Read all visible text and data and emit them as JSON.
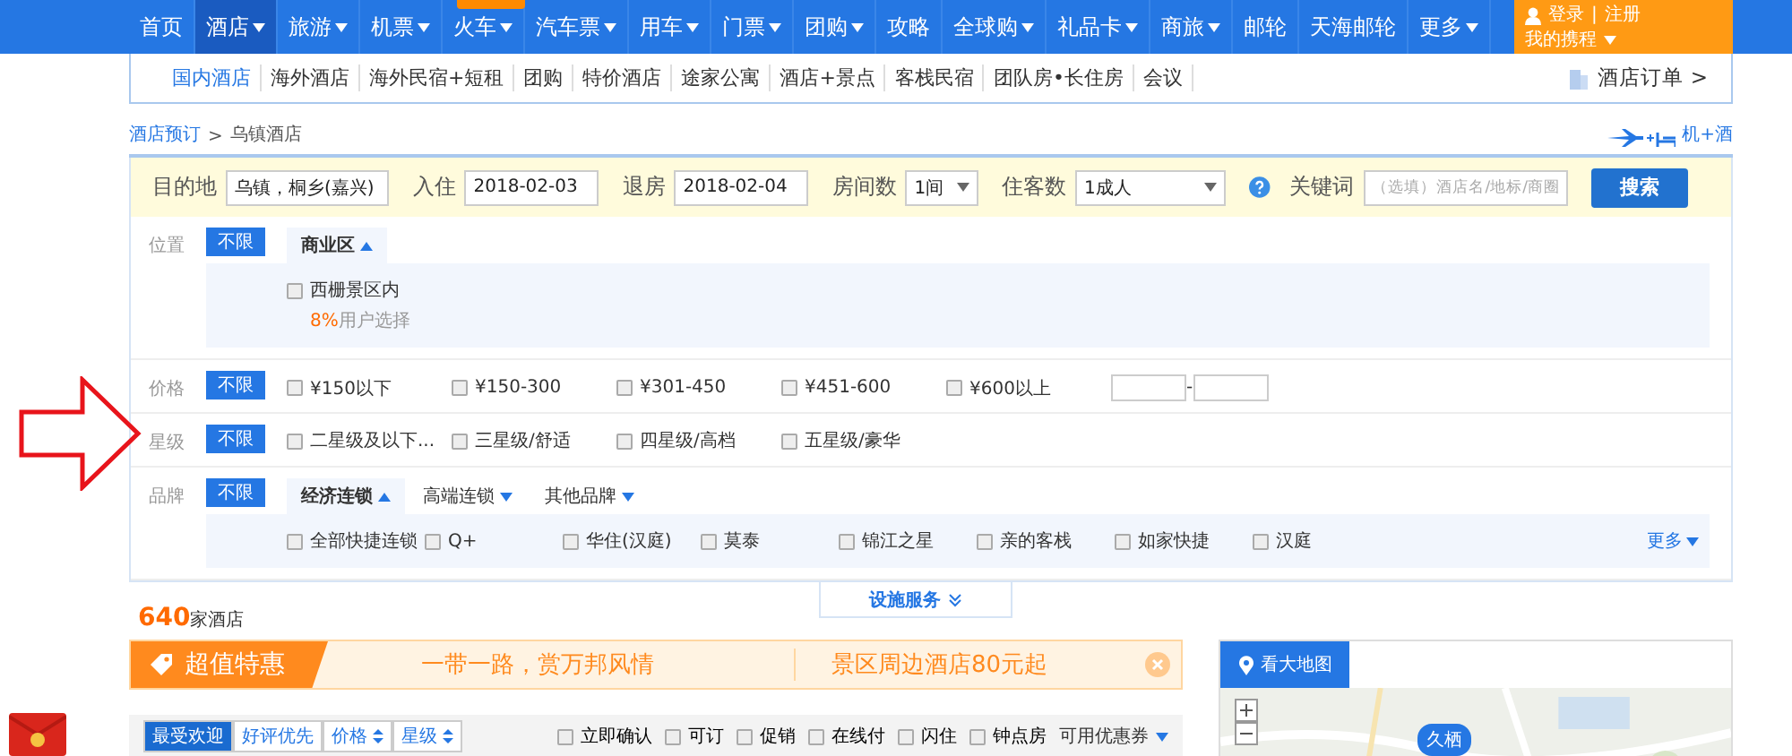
{
  "nav": {
    "items": [
      {
        "label": "首页",
        "selected": false,
        "caret": false
      },
      {
        "label": "酒店",
        "selected": true,
        "caret": true
      },
      {
        "label": "旅游",
        "selected": false,
        "caret": true
      },
      {
        "label": "机票",
        "selected": false,
        "caret": true
      },
      {
        "label": "火车",
        "selected": false,
        "caret": true,
        "badge": true
      },
      {
        "label": "汽车票",
        "selected": false,
        "caret": true
      },
      {
        "label": "用车",
        "selected": false,
        "caret": true
      },
      {
        "label": "门票",
        "selected": false,
        "caret": true
      },
      {
        "label": "团购",
        "selected": false,
        "caret": true
      },
      {
        "label": "攻略",
        "selected": false,
        "caret": false
      },
      {
        "label": "全球购",
        "selected": false,
        "caret": true
      },
      {
        "label": "礼品卡",
        "selected": false,
        "caret": true
      },
      {
        "label": "商旅",
        "selected": false,
        "caret": true
      },
      {
        "label": "邮轮",
        "selected": false,
        "caret": false
      },
      {
        "label": "天海邮轮",
        "selected": false,
        "caret": false
      },
      {
        "label": "更多",
        "selected": false,
        "caret": true
      }
    ],
    "account": {
      "login": "登录",
      "separator": "|",
      "register": "注册",
      "my": "我的携程"
    }
  },
  "subnav": {
    "items": [
      {
        "label": "国内酒店",
        "selected": true
      },
      {
        "label": "海外酒店",
        "selected": false
      },
      {
        "label": "海外民宿+短租",
        "selected": false
      },
      {
        "label": "团购",
        "selected": false
      },
      {
        "label": "特价酒店",
        "selected": false
      },
      {
        "label": "途家公寓",
        "selected": false
      },
      {
        "label": "酒店+景点",
        "selected": false
      },
      {
        "label": "客栈民宿",
        "selected": false
      },
      {
        "label": "团队房•长住房",
        "selected": false
      },
      {
        "label": "会议",
        "selected": false
      }
    ],
    "orders": "酒店订单 >"
  },
  "breadcrumb": {
    "link": "酒店预订",
    "sep": ">",
    "current": "乌镇酒店",
    "combo": "机+酒"
  },
  "search": {
    "fields": [
      {
        "kind": "text",
        "label": "目的地",
        "value": "乌镇，桐乡(嘉兴)"
      },
      {
        "kind": "text",
        "label": "入住",
        "value": "2018-02-03"
      },
      {
        "kind": "text",
        "label": "退房",
        "value": "2018-02-04"
      },
      {
        "kind": "select",
        "label": "房间数",
        "value": "1间"
      },
      {
        "kind": "select",
        "label": "住客数",
        "value": "1成人",
        "help": true
      },
      {
        "kind": "text",
        "label": "关键词",
        "placeholder": "（选填）酒店名/地标/商圈"
      }
    ],
    "button": "搜索"
  },
  "filters": [
    {
      "label": "位置",
      "any": "不限",
      "tabs": [
        {
          "label": "商业区",
          "selected": true
        }
      ],
      "panel": [
        {
          "label": "西栅景区内",
          "checked": false,
          "share": "8%",
          "share_text": "用户选择"
        }
      ]
    },
    {
      "label": "价格",
      "any": "不限",
      "options": [
        {
          "label": "¥150以下",
          "checked": false
        },
        {
          "label": "¥150-300",
          "checked": false
        },
        {
          "label": "¥301-450",
          "checked": false
        },
        {
          "label": "¥451-600",
          "checked": false
        },
        {
          "label": "¥600以上",
          "checked": false
        }
      ],
      "range": true,
      "range_sep": "-"
    },
    {
      "label": "星级",
      "any": "不限",
      "options": [
        {
          "label": "二星级及以下...",
          "checked": false
        },
        {
          "label": "三星级/舒适",
          "checked": false
        },
        {
          "label": "四星级/高档",
          "checked": false
        },
        {
          "label": "五星级/豪华",
          "checked": false
        }
      ]
    },
    {
      "label": "品牌",
      "any": "不限",
      "tabs": [
        {
          "label": "经济连锁",
          "selected": true
        },
        {
          "label": "高端连锁",
          "selected": false
        },
        {
          "label": "其他品牌",
          "selected": false
        }
      ],
      "panel": [
        {
          "label": "全部快捷连锁",
          "checked": false
        },
        {
          "label": "Q+",
          "checked": false
        },
        {
          "label": "华住(汉庭)",
          "checked": false
        },
        {
          "label": "莫泰",
          "checked": false
        },
        {
          "label": "锦江之星",
          "checked": false
        },
        {
          "label": "亲的客栈",
          "checked": false
        },
        {
          "label": "如家快捷",
          "checked": false
        },
        {
          "label": "汉庭",
          "checked": false
        }
      ],
      "more": "更多"
    }
  ],
  "facilities": "设施服务",
  "count": {
    "number": "640",
    "text": "家酒店"
  },
  "banner": {
    "title": "超值特惠",
    "left": "一带一路，赏万邦风情",
    "right": "景区周边酒店80元起"
  },
  "sort": {
    "tabs": [
      {
        "label": "最受欢迎",
        "selected": true,
        "caret": false
      },
      {
        "label": "好评优先",
        "selected": false,
        "caret": false
      },
      {
        "label": "价格",
        "selected": false,
        "caret": true
      },
      {
        "label": "星级",
        "selected": false,
        "caret": true
      }
    ],
    "checks": [
      {
        "label": "立即确认",
        "checked": false
      },
      {
        "label": "可订",
        "checked": false
      },
      {
        "label": "促销",
        "checked": false
      },
      {
        "label": "在线付",
        "checked": false
      },
      {
        "label": "闪住",
        "checked": false
      },
      {
        "label": "钟点房",
        "checked": false
      }
    ],
    "coupon": "可用优惠券"
  },
  "map": {
    "button": "看大地图",
    "pin": "久栖"
  }
}
